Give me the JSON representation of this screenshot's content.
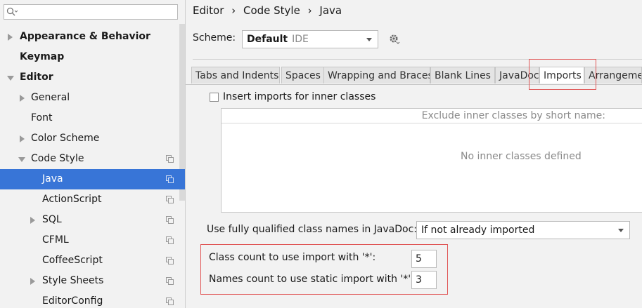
{
  "sidebar": {
    "search": {
      "placeholder": ""
    },
    "items": [
      {
        "label": "Appearance & Behavior"
      },
      {
        "label": "Keymap"
      },
      {
        "label": "Editor"
      },
      {
        "label": "General"
      },
      {
        "label": "Font"
      },
      {
        "label": "Color Scheme"
      },
      {
        "label": "Code Style"
      },
      {
        "label": "Java"
      },
      {
        "label": "ActionScript"
      },
      {
        "label": "SQL"
      },
      {
        "label": "CFML"
      },
      {
        "label": "CoffeeScript"
      },
      {
        "label": "Style Sheets"
      },
      {
        "label": "EditorConfig"
      }
    ]
  },
  "breadcrumb": [
    "Editor",
    "›",
    "Code Style",
    "›",
    "Java"
  ],
  "scheme": {
    "label": "Scheme:",
    "value": "Default",
    "sub": "IDE"
  },
  "tabs": [
    "Tabs and Indents",
    "Spaces",
    "Wrapping and Braces",
    "Blank Lines",
    "JavaDoc",
    "Imports",
    "Arrangemen"
  ],
  "imports": {
    "insert_inner_label": "Insert imports for inner classes",
    "exclude_header": "Exclude inner classes by short name:",
    "exclude_empty": "No inner classes defined",
    "fq_label": "Use fully qualified class names in JavaDoc:",
    "fq_value": "If not already imported",
    "class_count_label": "Class count to use import with '*':",
    "class_count_value": "5",
    "names_count_label": "Names count to use static import with '*':",
    "names_count_value": "3"
  },
  "colors": {
    "selection": "#3875d7",
    "highlight": "#e05656"
  }
}
